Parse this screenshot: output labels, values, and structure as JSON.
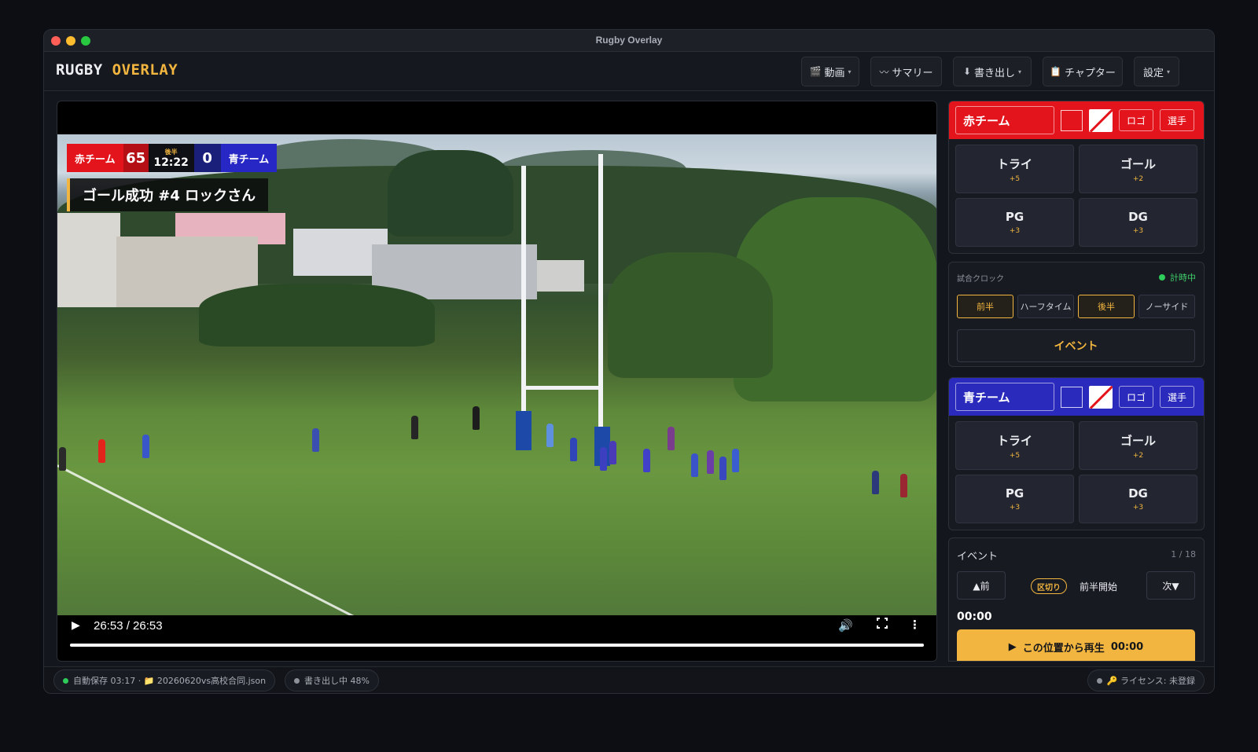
{
  "window": {
    "title": "Rugby Overlay"
  },
  "brand": {
    "part1": "RUGBY",
    "part2": "OVERLAY"
  },
  "menu": [
    {
      "icon": "🎬",
      "label": "動画",
      "caret": "▾"
    },
    {
      "icon": "〰",
      "label": "サマリー",
      "caret": ""
    },
    {
      "icon": "⬇",
      "label": "書き出し",
      "caret": "▾"
    },
    {
      "icon": "📋",
      "label": "チャプター",
      "caret": ""
    },
    {
      "icon": "",
      "label": "設定",
      "caret": "▾"
    }
  ],
  "scoreboard": {
    "red_name": "赤チーム",
    "red_score": "65",
    "half": "後半",
    "clock": "12:22",
    "blue_score": "0",
    "blue_name": "青チーム"
  },
  "caption": "ゴール成功 #4 ロックさん",
  "player": {
    "play_icon": "▶",
    "time": "26:53 / 26:53",
    "volume_icon": "🔊",
    "more_icon": "⋮",
    "progress": 1.0
  },
  "red_team": {
    "name": "赤チーム",
    "color": "#e3141c",
    "logo_btn": "ロゴ",
    "players_btn": "選手",
    "buttons": [
      {
        "label": "トライ",
        "pts": "+5"
      },
      {
        "label": "ゴール",
        "pts": "+2"
      },
      {
        "label": "PG",
        "pts": "+3"
      },
      {
        "label": "DG",
        "pts": "+3"
      }
    ]
  },
  "clock": {
    "title": "試合クロック",
    "status": "計時中",
    "phases": [
      {
        "label": "前半",
        "active": true
      },
      {
        "label": "ハーフタイム",
        "active": false
      },
      {
        "label": "後半",
        "active": true
      },
      {
        "label": "ノーサイド",
        "active": false
      }
    ],
    "event_btn": "イベント"
  },
  "blue_team": {
    "name": "青チーム",
    "color": "#2a2abd",
    "logo_btn": "ロゴ",
    "players_btn": "選手",
    "buttons": [
      {
        "label": "トライ",
        "pts": "+5"
      },
      {
        "label": "ゴール",
        "pts": "+2"
      },
      {
        "label": "PG",
        "pts": "+3"
      },
      {
        "label": "DG",
        "pts": "+3"
      }
    ]
  },
  "events": {
    "title": "イベント",
    "count": "1 / 18",
    "prev": "▲前",
    "next": "次▼",
    "tag": "区切り",
    "label": "前半開始",
    "time": "00:00",
    "play_here": "この位置から再生",
    "play_time": "00:00"
  },
  "status": {
    "autosave": "自動保存 03:17 · 📁 20260620vs高校合同.json",
    "export": "書き出し中 48%",
    "license": "🔑 ライセンス: 未登録"
  },
  "colors": {
    "accent": "#f2b53f",
    "red": "#e3141c",
    "blue": "#2a2abd",
    "ok": "#2ecc5a"
  }
}
